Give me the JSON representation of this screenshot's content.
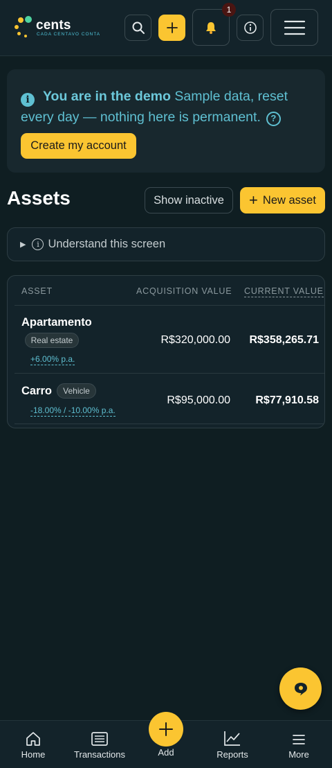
{
  "header": {
    "logo_text": "cents",
    "logo_tagline": "CADA CENTAVO CONTA",
    "notification_count": "1",
    "icons": [
      "search-icon",
      "plus-icon",
      "bell-icon",
      "info-icon",
      "menu-icon"
    ]
  },
  "demo_banner": {
    "title": "You are in the demo",
    "message": "Sample data, reset every day — nothing here is permanent.",
    "help_glyph": "?",
    "cta_label": "Create my account"
  },
  "page": {
    "title": "Assets",
    "show_inactive_label": "Show inactive",
    "new_asset_label": "New asset",
    "understand_label": "Understand this screen"
  },
  "table": {
    "columns": [
      "ASSET",
      "ACQUISITION VALUE",
      "CURRENT VALUE"
    ],
    "rows": [
      {
        "name": "Apartamento",
        "category": "Real estate",
        "rate": "+6.00% p.a.",
        "acquisition_value": "R$320,000.00",
        "current_value": "R$358,265.71"
      },
      {
        "name": "Carro",
        "category": "Vehicle",
        "rate": "-18.00% / -10.00% p.a.",
        "acquisition_value": "R$95,000.00",
        "current_value": "R$77,910.58"
      }
    ]
  },
  "bottom_nav": {
    "items": [
      {
        "label": "Home",
        "icon": "home-icon"
      },
      {
        "label": "Transactions",
        "icon": "list-icon"
      },
      {
        "label": "Add",
        "icon": "plus-icon"
      },
      {
        "label": "Reports",
        "icon": "chart-icon"
      },
      {
        "label": "More",
        "icon": "menu-icon"
      }
    ]
  },
  "colors": {
    "background": "#0f1e22",
    "accent": "#fbc531",
    "info": "#5fc0d2"
  }
}
